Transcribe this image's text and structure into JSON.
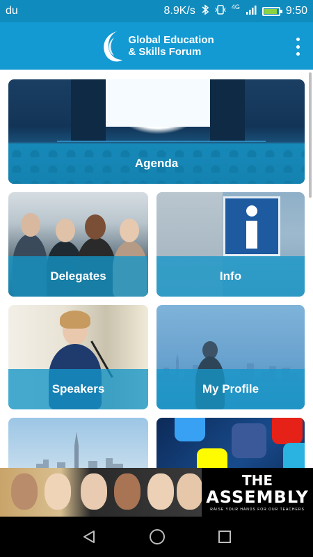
{
  "status_bar": {
    "carrier": "du",
    "speed": "8.9K/s",
    "network": "4G",
    "time": "9:50"
  },
  "app_bar": {
    "logo_line1": "Global Education",
    "logo_line2": "& Skills Forum"
  },
  "tiles": [
    {
      "label": "Agenda"
    },
    {
      "label": "Delegates"
    },
    {
      "label": "Info"
    },
    {
      "label": "Speakers"
    },
    {
      "label": "My Profile"
    },
    {
      "label": ""
    },
    {
      "label": ""
    }
  ],
  "ad": {
    "title": "THE",
    "subtitle": "ASSEMBLY",
    "tagline": "RAISE YOUR HANDS FOR OUR TEACHERS"
  },
  "colors": {
    "status_bar": "#0f8bbd",
    "app_bar": "#139ad2",
    "label_band": "#1496c8"
  },
  "icons": {
    "bluetooth": "bluetooth-icon",
    "vibrate": "vibrate-icon",
    "signal": "signal-icon",
    "battery": "battery-icon",
    "menu": "more-vert-icon",
    "back": "back-triangle-icon",
    "home": "home-circle-icon",
    "recents": "recents-square-icon"
  }
}
